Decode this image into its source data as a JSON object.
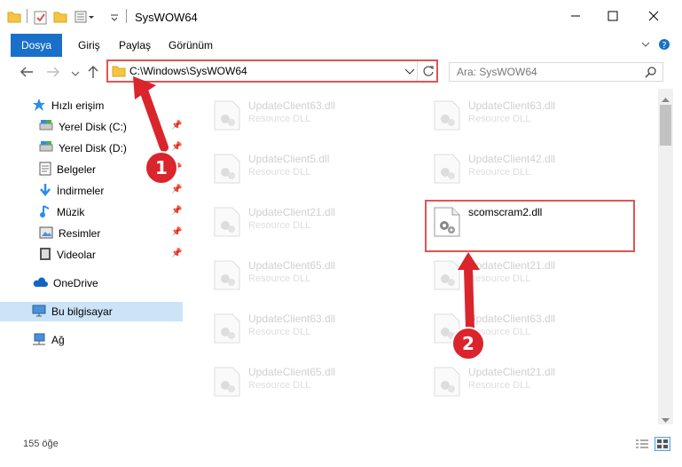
{
  "window": {
    "title": "SysWOW64",
    "controls": [
      "minimize-icon",
      "maximize-icon",
      "close-icon"
    ]
  },
  "ribbon": {
    "tabs": [
      {
        "label": "Dosya",
        "active": true
      },
      {
        "label": "Giriş"
      },
      {
        "label": "Paylaş"
      },
      {
        "label": "Görünüm"
      }
    ]
  },
  "address": {
    "path": "C:\\Windows\\SysWOW64",
    "search_placeholder": "Ara: SysWOW64"
  },
  "sidebar": {
    "items": [
      {
        "label": "Hızlı erişim",
        "icon": "star-icon"
      },
      {
        "label": "Yerel Disk (C:)",
        "icon": "drive-icon",
        "pinned": true
      },
      {
        "label": "Yerel Disk (D:)",
        "icon": "drive-icon",
        "pinned": true
      },
      {
        "label": "Belgeler",
        "icon": "documents-icon",
        "pinned": true
      },
      {
        "label": "İndirmeler",
        "icon": "download-icon",
        "pinned": true
      },
      {
        "label": "Müzik",
        "icon": "music-icon",
        "pinned": true
      },
      {
        "label": "Resimler",
        "icon": "pictures-icon",
        "pinned": true
      },
      {
        "label": "Videolar",
        "icon": "video-icon",
        "pinned": true
      },
      {
        "label": "OneDrive",
        "icon": "cloud-icon"
      },
      {
        "label": "Bu bilgisayar",
        "icon": "computer-icon",
        "selected": true
      },
      {
        "label": "Ağ",
        "icon": "network-icon"
      }
    ]
  },
  "files": [
    {
      "name": "UpdateClient63.dll",
      "type": "Resource DLL"
    },
    {
      "name": "UpdateClient63.dll",
      "type": "Resource DLL"
    },
    {
      "name": "UpdateClient5.dll",
      "type": "Resource DLL"
    },
    {
      "name": "UpdateClient42.dll",
      "type": "Resource DLL"
    },
    {
      "name": "UpdateClient21.dll",
      "type": "Resource DLL"
    },
    {
      "name": "scomscram2.dll",
      "type": ""
    },
    {
      "name": "UpdateClient65.dll",
      "type": "Resource DLL"
    },
    {
      "name": "UpdateClient21.dll",
      "type": "Resource DLL"
    },
    {
      "name": "UpdateClient63.dll",
      "type": "Resource DLL"
    },
    {
      "name": "UpdateClient63.dll",
      "type": "Resource DLL"
    },
    {
      "name": "UpdateClient65.dll",
      "type": "Resource DLL"
    },
    {
      "name": "UpdateClient21.dll",
      "type": "Resource DLL"
    }
  ],
  "status": {
    "count": "155 öğe"
  },
  "annotations": {
    "badge1": "1",
    "badge2": "2",
    "color": "#d9252b"
  }
}
